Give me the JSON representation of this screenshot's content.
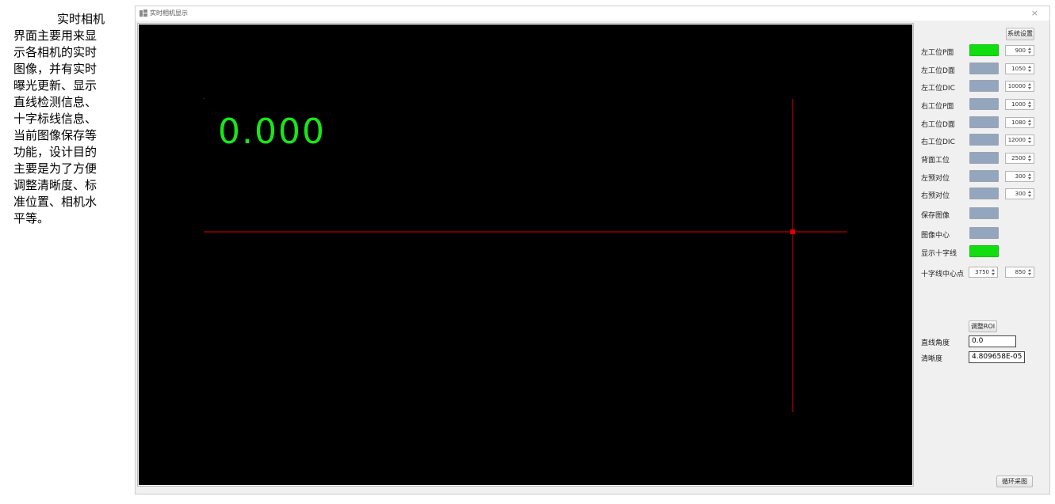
{
  "description": "实时相机界面主要用来显示各相机的实时图像，并有实时曝光更新、显示直线检测信息、十字标线信息、当前图像保存等功能，设计目的主要是为了方便调整清晰度、标准位置、相机水平等。",
  "window": {
    "title": "实时相机显示",
    "close_glyph": "×",
    "icon": "camera-window-icon"
  },
  "viewport": {
    "readout": "0.000",
    "readout_color": "#19e619",
    "crosshair_color": "#e00000",
    "background": "#000000"
  },
  "panel": {
    "system_settings_label": "系统设置",
    "colors": {
      "active": "#11dd11",
      "inactive": "#93a6bd"
    },
    "rows": [
      {
        "label": "左工位P面",
        "state": "active",
        "value": "900"
      },
      {
        "label": "左工位D面",
        "state": "inactive",
        "value": "1050"
      },
      {
        "label": "左工位DIC",
        "state": "inactive",
        "value": "10000"
      },
      {
        "label": "右工位P面",
        "state": "inactive",
        "value": "1000"
      },
      {
        "label": "右工位D面",
        "state": "inactive",
        "value": "1080"
      },
      {
        "label": "右工位DIC",
        "state": "inactive",
        "value": "12000"
      },
      {
        "label": "背面工位",
        "state": "inactive",
        "value": "2500"
      },
      {
        "label": "左预对位",
        "state": "inactive",
        "value": "300"
      },
      {
        "label": "右预对位",
        "state": "inactive",
        "value": "300"
      }
    ],
    "save_image": {
      "label": "保存图像",
      "state": "inactive"
    },
    "image_center": {
      "label": "图像中心",
      "state": "inactive"
    },
    "show_crosshair": {
      "label": "显示十字线",
      "state": "active"
    },
    "crosshair_center": {
      "label": "十字线中心点",
      "x": "3750",
      "y": "850"
    },
    "adjust_roi_label": "调整ROI",
    "line_angle": {
      "label": "直线角度",
      "value": "0.0"
    },
    "sharpness": {
      "label": "清晰度",
      "value": "4.809658E-05"
    },
    "loop_capture_label": "循环采图"
  }
}
